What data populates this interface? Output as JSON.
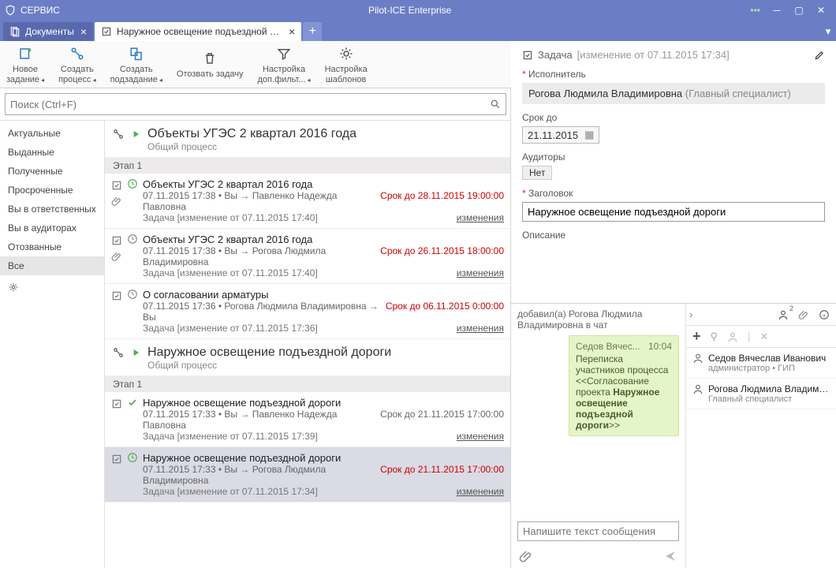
{
  "titlebar": {
    "menu": "СЕРВИС",
    "app_title": "Pilot-ICE Enterprise"
  },
  "tabs": {
    "documents": "Документы",
    "task_tab": "Наружное освещение подъездной дор..."
  },
  "toolbar": {
    "new_task": "Новое\nзадание",
    "new_process": "Создать\nпроцесс",
    "new_subtask": "Создать\nподзадание",
    "revoke": "Отозвать задачу",
    "extra_filter": "Настройка\nдоп.фильт...",
    "templates": "Настройка\nшаблонов"
  },
  "search": {
    "placeholder": "Поиск (Ctrl+F)"
  },
  "sidebar": {
    "items": [
      "Актуальные",
      "Выданные",
      "Полученные",
      "Просроченные",
      "Вы в ответственных",
      "Вы в аудиторах",
      "Отозванные",
      "Все"
    ],
    "selected_index": 7
  },
  "processes": [
    {
      "title": "Объекты УГЭС 2 квартал 2016 года",
      "subtitle": "Общий процесс",
      "stage": "Этап 1",
      "tasks": [
        {
          "title": "Объекты УГЭС 2 квартал 2016 года",
          "meta_left": "07.11.2015 17:38 • Вы → Павленко Надежда Павловна",
          "deadline": "Срок до 28.11.2015 19:00:00",
          "deadline_red": true,
          "type_line": "Задача  [изменение от 07.11.2015 17:40]",
          "link": "изменения",
          "status_icon": "clock-green",
          "attachment": true
        },
        {
          "title": "Объекты УГЭС 2 квартал 2016 года",
          "meta_left": "07.11.2015 17:38 • Вы → Рогова Людмила Владимировна",
          "deadline": "Срок до 26.11.2015 18:00:00",
          "deadline_red": true,
          "type_line": "Задача  [изменение от 07.11.2015 17:40]",
          "link": "изменения",
          "status_icon": "clock-grey",
          "attachment": true
        }
      ]
    },
    {
      "title": "",
      "tasks": [
        {
          "title": "О согласовании арматуры",
          "meta_left": "07.11.2015 17:36 • Рогова Людмила Владимировна → Вы",
          "deadline": "Срок до 06.11.2015 0:00:00",
          "deadline_red": true,
          "type_line": "Задача  [изменение от 07.11.2015 17:36]",
          "link": "изменения",
          "status_icon": "clock-grey"
        }
      ]
    },
    {
      "title": "Наружное освещение подъездной дороги",
      "subtitle": "Общий процесс",
      "stage": "Этап 1",
      "tasks": [
        {
          "title": "Наружное освещение подъездной дороги",
          "meta_left": "07.11.2015 17:33 • Вы → Павленко Надежда Павловна",
          "deadline": "Срок до 21.11.2015 17:00:00",
          "deadline_red": false,
          "type_line": "Задача  [изменение от 07.11.2015 17:39]",
          "link": "изменения",
          "status_icon": "check-green"
        },
        {
          "title": "Наружное освещение подъездной дороги",
          "meta_left": "07.11.2015 17:33 • Вы → Рогова Людмила Владимировна",
          "deadline": "Срок до 21.11.2015 17:00:00",
          "deadline_red": true,
          "type_line": "Задача  [изменение от 07.11.2015 17:34]",
          "link": "изменения",
          "status_icon": "clock-green",
          "selected": true
        }
      ]
    }
  ],
  "details": {
    "header_type": "Задача",
    "header_change": "[изменение от 07.11.2015 17:34]",
    "assignee_label": "Исполнитель",
    "assignee_name": "Рогова Людмила Владимировна",
    "assignee_role": "(Главный специалист)",
    "due_label": "Срок до",
    "due_value": "21.11.2015",
    "auditors_label": "Аудиторы",
    "auditors_value": "Нет",
    "title_label": "Заголовок",
    "title_value": "Наружное освещение подъездной дороги",
    "desc_label": "Описание"
  },
  "chat": {
    "sys_msg": "добавил(а) Рогова Людмила Владимировна в чат",
    "bubble_from": "Седов Вячес...",
    "bubble_time": "10:04",
    "bubble_body_plain": "Переписка участников процесса <<Согласование проекта ",
    "bubble_body_bold": "Наружное освещение подъездной дороги",
    "bubble_body_tail": ">>",
    "input_placeholder": "Напишите текст сообщения",
    "participants_badge": "2",
    "participants": [
      {
        "name": "Седов Вячеслав Иванович",
        "sub": "администратор • ГИП"
      },
      {
        "name": "Рогова Людмила Владимиров",
        "sub": "Главный специалист"
      }
    ]
  }
}
